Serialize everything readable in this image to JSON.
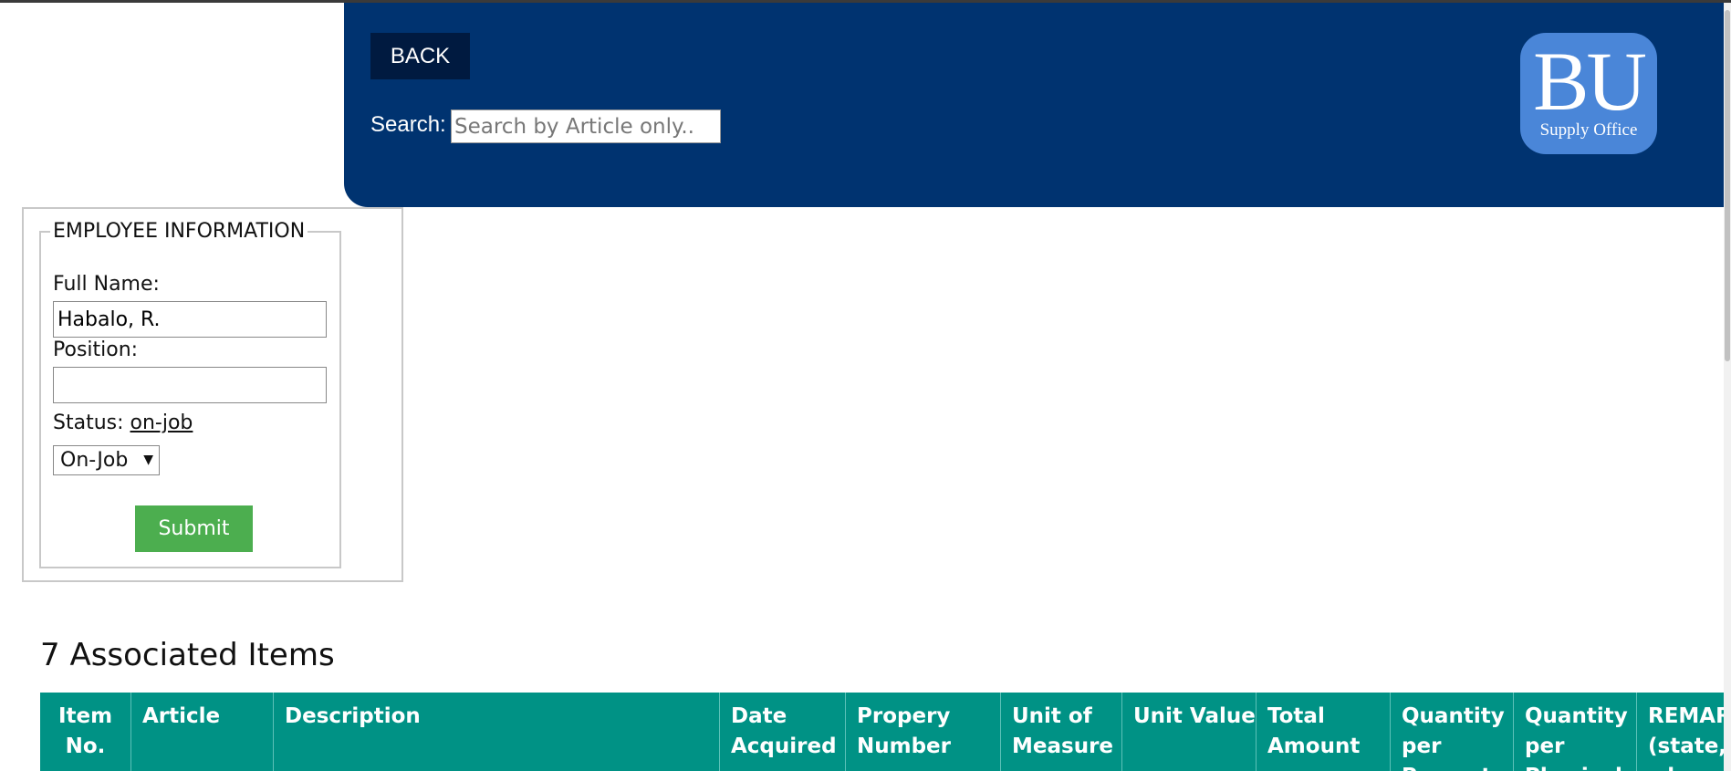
{
  "header": {
    "back_label": "BACK",
    "search_label": "Search:",
    "search_placeholder": "Search by Article only..",
    "logo_text": "BU",
    "logo_subtitle": "Supply Office",
    "background_color": "#003370"
  },
  "employee_form": {
    "legend": "EMPLOYEE INFORMATION",
    "full_name_label": "Full Name:",
    "full_name_value": "Habalo, R.",
    "position_label": "Position:",
    "position_value": "",
    "status_label": "Status:",
    "status_value": "on-job",
    "status_select_value": "On-Job",
    "submit_label": "Submit",
    "submit_color": "#4cae4f"
  },
  "items": {
    "heading": "7 Associated Items",
    "header_color": "#009285",
    "columns": [
      "Item No.",
      "Article",
      "Description",
      "Date Acquired",
      "Propery Number",
      "Unit of Measure",
      "Unit Value",
      "Total Amount",
      "Quantity per Property Card",
      "Quantity per Physical Count",
      "REMARKS (state, whereabouts)"
    ]
  }
}
